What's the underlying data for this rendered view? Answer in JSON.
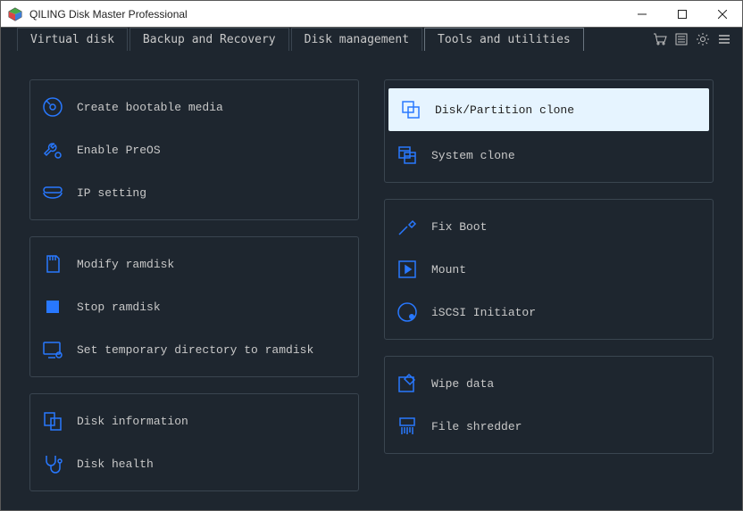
{
  "app": {
    "title": "QILING Disk Master Professional"
  },
  "tabs": {
    "virtual_disk": "Virtual disk",
    "backup_recovery": "Backup and Recovery",
    "disk_management": "Disk management",
    "tools_utilities": "Tools and utilities"
  },
  "left": {
    "g1": {
      "bootable": "Create bootable media",
      "preos": "Enable PreOS",
      "ip": "IP setting"
    },
    "g2": {
      "modify_ramdisk": "Modify ramdisk",
      "stop_ramdisk": "Stop ramdisk",
      "temp_dir": "Set temporary directory to ramdisk"
    },
    "g3": {
      "disk_info": "Disk information",
      "disk_health": "Disk health"
    }
  },
  "right": {
    "g1": {
      "disk_clone": "Disk/Partition clone",
      "system_clone": "System clone"
    },
    "g2": {
      "fix_boot": "Fix Boot",
      "mount": "Mount",
      "iscsi": "iSCSI Initiator"
    },
    "g3": {
      "wipe": "Wipe data",
      "shredder": "File shredder"
    }
  }
}
